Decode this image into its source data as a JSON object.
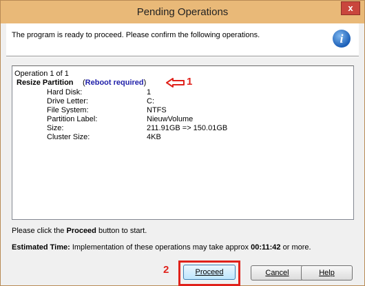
{
  "window": {
    "title": "Pending Operations",
    "close_label": "x"
  },
  "header": {
    "message": "The program is ready to proceed. Please confirm the following operations.",
    "icon": "info-icon"
  },
  "operation": {
    "count": "Operation 1 of 1",
    "name": "Resize Partition",
    "reboot_open": "(",
    "reboot_text": "Reboot required",
    "reboot_close": ")",
    "details": [
      {
        "label": "Hard Disk:",
        "value": "1"
      },
      {
        "label": "Drive Letter:",
        "value": "C:"
      },
      {
        "label": "File System:",
        "value": "NTFS"
      },
      {
        "label": "Partition Label:",
        "value": "NieuwVolume"
      },
      {
        "label": "Size:",
        "value": "211.91GB => 150.01GB"
      },
      {
        "label": "Cluster Size:",
        "value": "4KB"
      }
    ]
  },
  "footer": {
    "click_prefix": "Please click the ",
    "click_bold": "Proceed",
    "click_suffix": " button to start.",
    "estimated_label": "Estimated Time:",
    "estimated_text": " Implementation of these operations may take approx ",
    "estimated_time": "00:11:42",
    "estimated_suffix": " or more."
  },
  "buttons": {
    "proceed": "Proceed",
    "cancel": "Cancel",
    "help": "Help"
  },
  "annotations": {
    "marker_one": "1",
    "marker_two": "2",
    "color": "#e0211a"
  }
}
